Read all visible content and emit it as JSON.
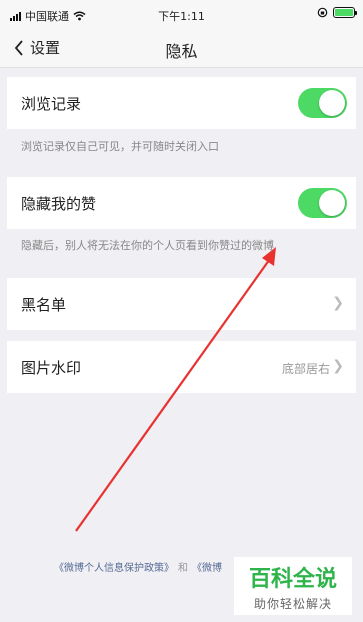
{
  "status_bar": {
    "carrier": "中国联通",
    "time": "下午1:11"
  },
  "nav": {
    "back_label": "设置",
    "title": "隐私"
  },
  "settings": {
    "browse_history": {
      "label": "浏览记录",
      "enabled": true,
      "hint": "浏览记录仅自己可见，并可随时关闭入口"
    },
    "hide_likes": {
      "label": "隐藏我的赞",
      "enabled": true,
      "hint": "隐藏后，别人将无法在你的个人页看到你赞过的微博"
    },
    "blacklist": {
      "label": "黑名单"
    },
    "watermark": {
      "label": "图片水印",
      "value": "底部居右"
    }
  },
  "footer": {
    "policy_link": "《微博个人信息保护政策》",
    "and": "和",
    "second_link": "《微博"
  },
  "overlay_watermark": {
    "title": "百科全说",
    "subtitle": "助你轻松解决"
  },
  "colors": {
    "toggle_on": "#4cd964",
    "link": "#576b95",
    "arrow": "#e8322f",
    "watermark_green": "#2fb44b"
  }
}
